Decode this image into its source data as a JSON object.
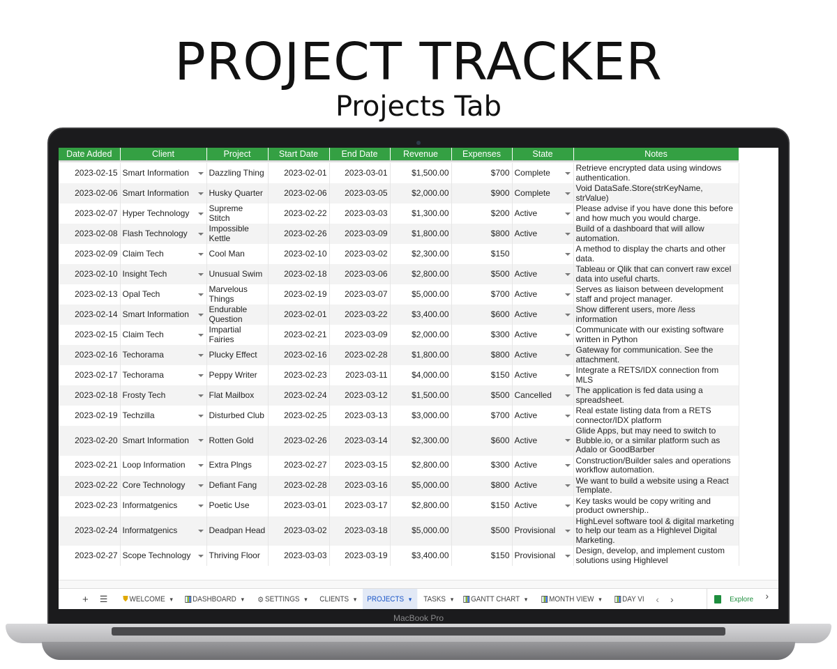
{
  "heading": {
    "title": "PROJECT TRACKER",
    "subtitle": "Projects Tab"
  },
  "device": {
    "brand": "MacBook Pro"
  },
  "colors": {
    "header_bg": "#34a043",
    "active_tab": "#1a56c8",
    "alt_row": "#f3f3f3"
  },
  "table": {
    "columns": [
      "Date Added",
      "Client",
      "Project",
      "Start Date",
      "End Date",
      "Revenue",
      "Expenses",
      "State",
      "Notes"
    ],
    "rows": [
      [
        "2023-02-15",
        "Smart Information",
        "Dazzling Thing",
        "2023-02-01",
        "2023-03-01",
        "$1,500.00",
        "$700",
        "Complete",
        "Retrieve encrypted data using windows authentication."
      ],
      [
        "2023-02-06",
        "Smart Information",
        "Husky Quarter",
        "2023-02-06",
        "2023-03-05",
        "$2,000.00",
        "$900",
        "Complete",
        "Void DataSafe.Store(strKeyName, strValue)"
      ],
      [
        "2023-02-07",
        "Hyper Technology",
        "Supreme Stitch",
        "2023-02-22",
        "2023-03-03",
        "$1,300.00",
        "$200",
        "Active",
        "Please advise if you have done this before and how much you would charge."
      ],
      [
        "2023-02-08",
        "Flash Technology",
        "Impossible Kettle",
        "2023-02-26",
        "2023-03-09",
        "$1,800.00",
        "$800",
        "Active",
        "Build of a dashboard that will allow automation."
      ],
      [
        "2023-02-09",
        "Claim Tech",
        "Cool Man",
        "2023-02-10",
        "2023-03-02",
        "$2,300.00",
        "$150",
        "",
        "A method to display the charts and other data."
      ],
      [
        "2023-02-10",
        "Insight Tech",
        "Unusual Swim",
        "2023-02-18",
        "2023-03-06",
        "$2,800.00",
        "$500",
        "Active",
        "Tableau or Qlik that can convert raw excel data into useful charts."
      ],
      [
        "2023-02-13",
        "Opal Tech",
        "Marvelous Things",
        "2023-02-19",
        "2023-03-07",
        "$5,000.00",
        "$700",
        "Active",
        "Serves as liaison between development staff and project manager."
      ],
      [
        "2023-02-14",
        "Smart Information",
        "Endurable Question",
        "2023-02-01",
        "2023-03-22",
        "$3,400.00",
        "$600",
        "Active",
        "Show different users, more /less information"
      ],
      [
        "2023-02-15",
        "Claim Tech",
        "Impartial Fairies",
        "2023-02-21",
        "2023-03-09",
        "$2,000.00",
        "$300",
        "Active",
        "Communicate with our existing software written in Python"
      ],
      [
        "2023-02-16",
        "Techorama",
        "Plucky Effect",
        "2023-02-16",
        "2023-02-28",
        "$1,800.00",
        "$800",
        "Active",
        "Gateway for communication. See the attachment."
      ],
      [
        "2023-02-17",
        "Techorama",
        "Peppy Writer",
        "2023-02-23",
        "2023-03-11",
        "$4,000.00",
        "$150",
        "Active",
        "Integrate a RETS/IDX connection from MLS"
      ],
      [
        "2023-02-18",
        "Frosty Tech",
        "Flat Mailbox",
        "2023-02-24",
        "2023-03-12",
        "$1,500.00",
        "$500",
        "Cancelled",
        "The application is fed data using a spreadsheet."
      ],
      [
        "2023-02-19",
        "Techzilla",
        "Disturbed Club",
        "2023-02-25",
        "2023-03-13",
        "$3,000.00",
        "$700",
        "Active",
        "Real estate listing data from a RETS connector/IDX platform"
      ],
      [
        "2023-02-20",
        "Smart Information",
        "Rotten Gold",
        "2023-02-26",
        "2023-03-14",
        "$2,300.00",
        "$600",
        "Active",
        "Glide Apps, but may need to switch to Bubble.io, or a similar platform such as Adalo or GoodBarber"
      ],
      [
        "2023-02-21",
        "Loop Information",
        "Extra Plngs",
        "2023-02-27",
        "2023-03-15",
        "$2,800.00",
        "$300",
        "Active",
        "Construction/Builder sales and operations workflow automation."
      ],
      [
        "2023-02-22",
        "Core Technology",
        "Defiant Fang",
        "2023-02-28",
        "2023-03-16",
        "$5,000.00",
        "$800",
        "Active",
        "We want to build a website using a React Template."
      ],
      [
        "2023-02-23",
        "Informatgenics",
        "Poetic Use",
        "2023-03-01",
        "2023-03-17",
        "$2,800.00",
        "$150",
        "Active",
        "Key tasks would be copy writing and product ownership.."
      ],
      [
        "2023-02-24",
        "Informatgenics",
        "Deadpan Head",
        "2023-03-02",
        "2023-03-18",
        "$5,000.00",
        "$500",
        "Provisional",
        "HighLevel software tool & digital marketing to help our team as a Highlevel Digital Marketing."
      ],
      [
        "2023-02-27",
        "Scope Technology",
        "Thriving Floor",
        "2023-03-03",
        "2023-03-19",
        "$3,400.00",
        "$150",
        "Provisional",
        "Design, develop, and implement custom solutions using Highlevel"
      ]
    ]
  },
  "sheet_tabs": [
    {
      "label": "WELCOME",
      "icon": "shield-icon"
    },
    {
      "label": "DASHBOARD",
      "icon": "chart-icon"
    },
    {
      "label": "SETTINGS",
      "icon": "gear-icon"
    },
    {
      "label": "CLIENTS",
      "icon": ""
    },
    {
      "label": "PROJECTS",
      "icon": "",
      "active": true
    },
    {
      "label": "TASKS",
      "icon": ""
    },
    {
      "label": "GANTT CHART",
      "icon": "chart-icon"
    },
    {
      "label": "MONTH VIEW",
      "icon": "chart-icon"
    },
    {
      "label": "DAY VI",
      "icon": "chart-icon"
    }
  ],
  "toolbar": {
    "add": "+",
    "menu": "☰",
    "prev": "‹",
    "next": "›",
    "explore": "Explore",
    "side": "›"
  }
}
